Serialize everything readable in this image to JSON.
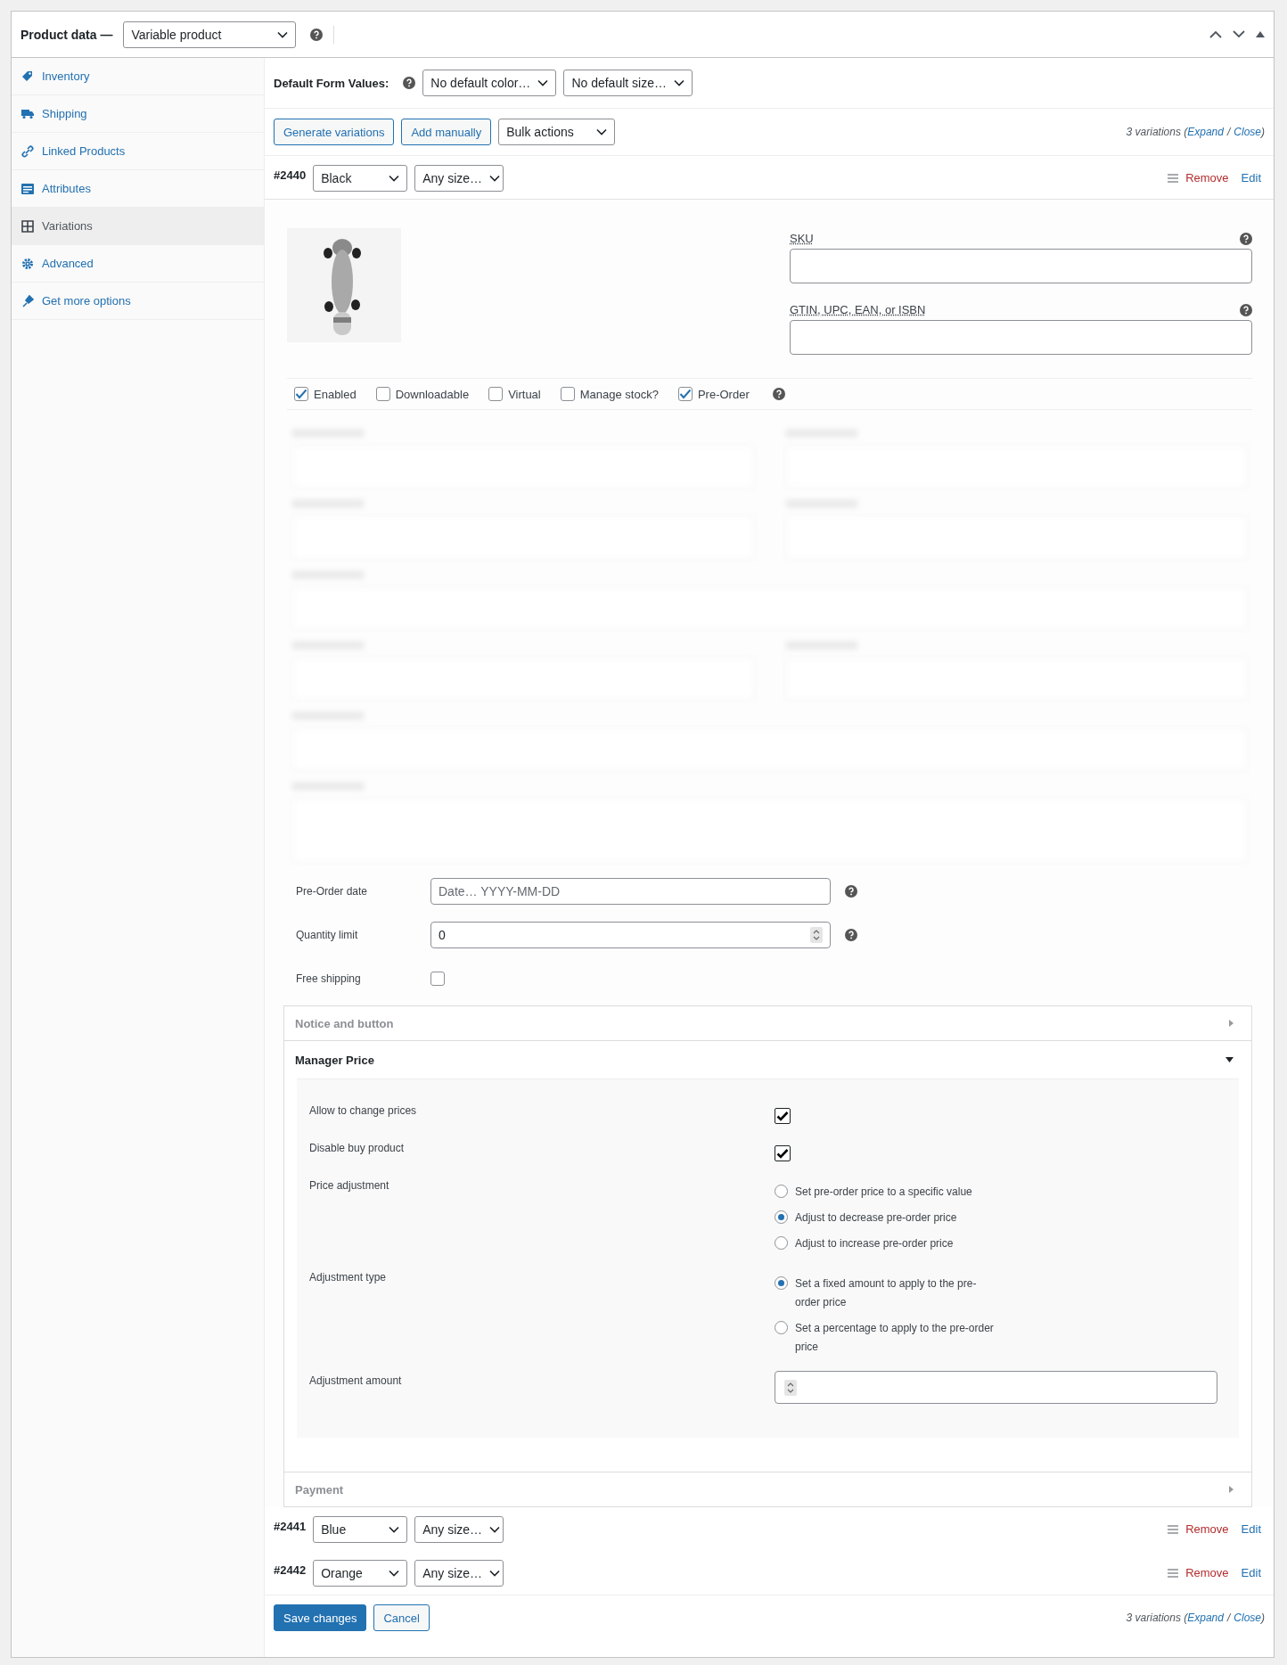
{
  "panel": {
    "title": "Product data —",
    "product_type": "Variable product"
  },
  "tabs": [
    {
      "label": "Inventory",
      "selected": false
    },
    {
      "label": "Shipping",
      "selected": false
    },
    {
      "label": "Linked Products",
      "selected": false
    },
    {
      "label": "Attributes",
      "selected": false
    },
    {
      "label": "Variations",
      "selected": true
    },
    {
      "label": "Advanced",
      "selected": false
    },
    {
      "label": "Get more options",
      "selected": false
    }
  ],
  "default_form_values": {
    "label": "Default Form Values:",
    "selects": [
      "No default color…",
      "No default size…"
    ]
  },
  "toolbar": {
    "buttons": [
      "Generate variations",
      "Add manually"
    ],
    "bulk": "Bulk actions",
    "count": "3 variations (",
    "expand": "Expand",
    "separator": "/",
    "close": "Close",
    "end": ")"
  },
  "variations": [
    {
      "id": "#2440",
      "option": "Black",
      "size": "Any size…",
      "expanded": true,
      "remove": "Remove",
      "edit": "Edit"
    },
    {
      "id": "#2441",
      "option": "Blue",
      "size": "Any size…",
      "expanded": false,
      "remove": "Remove",
      "edit": "Edit"
    },
    {
      "id": "#2442",
      "option": "Orange",
      "size": "Any size…",
      "expanded": false,
      "remove": "Remove",
      "edit": "Edit"
    }
  ],
  "details": {
    "fields": [
      {
        "label": "SKU"
      },
      {
        "label": "GTIN, UPC, EAN, or ISBN"
      }
    ],
    "options": [
      {
        "label": "Enabled",
        "checked": true
      },
      {
        "label": "Downloadable",
        "checked": false
      },
      {
        "label": "Virtual",
        "checked": false
      },
      {
        "label": "Manage stock?",
        "checked": false
      },
      {
        "label": "Pre-Order",
        "checked": true
      }
    ],
    "hidden_fields": {
      "kind": "blurred"
    },
    "preorder": [
      {
        "kind": "text",
        "label": "Pre-Order date",
        "placeholder": "Date… YYYY-MM-DD"
      },
      {
        "kind": "number",
        "label": "Quantity limit",
        "value": "0"
      },
      {
        "kind": "checkbox",
        "label": "Free shipping",
        "checked": false
      }
    ],
    "sections": [
      {
        "title": "Notice and button",
        "expanded": false
      },
      {
        "title": "Manager Price",
        "expanded": true,
        "rows": [
          {
            "kind": "checkbox",
            "label": "Allow to change prices",
            "checked": true
          },
          {
            "kind": "checkbox",
            "label": "Disable buy product",
            "checked": true
          },
          {
            "kind": "radio",
            "label": "Price adjustment",
            "options": [
              {
                "label": "Set pre-order price to a specific value",
                "selected": false
              },
              {
                "label": "Adjust to decrease pre-order price",
                "selected": true
              },
              {
                "label": "Adjust to increase pre-order price",
                "selected": false
              }
            ]
          },
          {
            "kind": "radio",
            "label": "Adjustment type",
            "options": [
              {
                "label": "Set a fixed amount to apply to the pre-order price",
                "selected": true
              },
              {
                "label": "Set a percentage to apply to the pre-order price",
                "selected": false
              }
            ]
          },
          {
            "kind": "number",
            "label": "Adjustment amount"
          }
        ]
      },
      {
        "title": "Payment",
        "expanded": false
      }
    ]
  },
  "footer": {
    "save": "Save changes",
    "cancel": "Cancel",
    "count": "3 variations (",
    "expand": "Expand",
    "separator": "/",
    "close": "Close",
    "end": ")"
  }
}
